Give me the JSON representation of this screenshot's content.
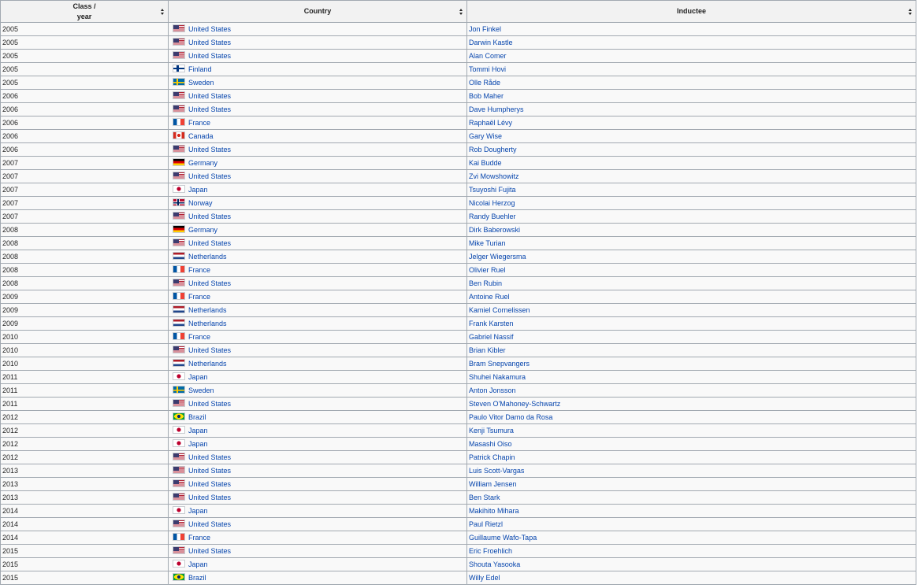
{
  "table": {
    "headers": {
      "year": "Class / year",
      "country": "Country",
      "inductee": "Inductee"
    },
    "rows": [
      {
        "year": "2005",
        "country": "United States",
        "flag": "us",
        "inductee": "Jon Finkel"
      },
      {
        "year": "2005",
        "country": "United States",
        "flag": "us",
        "inductee": "Darwin Kastle"
      },
      {
        "year": "2005",
        "country": "United States",
        "flag": "us",
        "inductee": "Alan Comer"
      },
      {
        "year": "2005",
        "country": "Finland",
        "flag": "fi",
        "inductee": "Tommi Hovi"
      },
      {
        "year": "2005",
        "country": "Sweden",
        "flag": "se",
        "inductee": "Olle Råde"
      },
      {
        "year": "2006",
        "country": "United States",
        "flag": "us",
        "inductee": "Bob Maher"
      },
      {
        "year": "2006",
        "country": "United States",
        "flag": "us",
        "inductee": "Dave Humpherys"
      },
      {
        "year": "2006",
        "country": "France",
        "flag": "fr",
        "inductee": "Raphaël Lévy"
      },
      {
        "year": "2006",
        "country": "Canada",
        "flag": "ca",
        "inductee": "Gary Wise"
      },
      {
        "year": "2006",
        "country": "United States",
        "flag": "us",
        "inductee": "Rob Dougherty"
      },
      {
        "year": "2007",
        "country": "Germany",
        "flag": "de",
        "inductee": "Kai Budde"
      },
      {
        "year": "2007",
        "country": "United States",
        "flag": "us",
        "inductee": "Zvi Mowshowitz"
      },
      {
        "year": "2007",
        "country": "Japan",
        "flag": "jp",
        "inductee": "Tsuyoshi Fujita"
      },
      {
        "year": "2007",
        "country": "Norway",
        "flag": "no",
        "inductee": "Nicolai Herzog"
      },
      {
        "year": "2007",
        "country": "United States",
        "flag": "us",
        "inductee": "Randy Buehler"
      },
      {
        "year": "2008",
        "country": "Germany",
        "flag": "de",
        "inductee": "Dirk Baberowski"
      },
      {
        "year": "2008",
        "country": "United States",
        "flag": "us",
        "inductee": "Mike Turian"
      },
      {
        "year": "2008",
        "country": "Netherlands",
        "flag": "nl",
        "inductee": "Jelger Wiegersma"
      },
      {
        "year": "2008",
        "country": "France",
        "flag": "fr",
        "inductee": "Olivier Ruel"
      },
      {
        "year": "2008",
        "country": "United States",
        "flag": "us",
        "inductee": "Ben Rubin"
      },
      {
        "year": "2009",
        "country": "France",
        "flag": "fr",
        "inductee": "Antoine Ruel"
      },
      {
        "year": "2009",
        "country": "Netherlands",
        "flag": "nl",
        "inductee": "Kamiel Cornelissen"
      },
      {
        "year": "2009",
        "country": "Netherlands",
        "flag": "nl",
        "inductee": "Frank Karsten"
      },
      {
        "year": "2010",
        "country": "France",
        "flag": "fr",
        "inductee": "Gabriel Nassif"
      },
      {
        "year": "2010",
        "country": "United States",
        "flag": "us",
        "inductee": "Brian Kibler"
      },
      {
        "year": "2010",
        "country": "Netherlands",
        "flag": "nl",
        "inductee": "Bram Snepvangers"
      },
      {
        "year": "2011",
        "country": "Japan",
        "flag": "jp",
        "inductee": "Shuhei Nakamura"
      },
      {
        "year": "2011",
        "country": "Sweden",
        "flag": "se",
        "inductee": "Anton Jonsson"
      },
      {
        "year": "2011",
        "country": "United States",
        "flag": "us",
        "inductee": "Steven O'Mahoney-Schwartz"
      },
      {
        "year": "2012",
        "country": "Brazil",
        "flag": "br",
        "inductee": "Paulo Vitor Damo da Rosa"
      },
      {
        "year": "2012",
        "country": "Japan",
        "flag": "jp",
        "inductee": "Kenji Tsumura"
      },
      {
        "year": "2012",
        "country": "Japan",
        "flag": "jp",
        "inductee": "Masashi Oiso"
      },
      {
        "year": "2012",
        "country": "United States",
        "flag": "us",
        "inductee": "Patrick Chapin"
      },
      {
        "year": "2013",
        "country": "United States",
        "flag": "us",
        "inductee": "Luis Scott-Vargas"
      },
      {
        "year": "2013",
        "country": "United States",
        "flag": "us",
        "inductee": "William Jensen"
      },
      {
        "year": "2013",
        "country": "United States",
        "flag": "us",
        "inductee": "Ben Stark"
      },
      {
        "year": "2014",
        "country": "Japan",
        "flag": "jp",
        "inductee": "Makihito Mihara"
      },
      {
        "year": "2014",
        "country": "United States",
        "flag": "us",
        "inductee": "Paul Rietzl"
      },
      {
        "year": "2014",
        "country": "France",
        "flag": "fr",
        "inductee": "Guillaume Wafo-Tapa"
      },
      {
        "year": "2015",
        "country": "United States",
        "flag": "us",
        "inductee": "Eric Froehlich"
      },
      {
        "year": "2015",
        "country": "Japan",
        "flag": "jp",
        "inductee": "Shouta Yasooka"
      },
      {
        "year": "2015",
        "country": "Brazil",
        "flag": "br",
        "inductee": "Willy Edel"
      }
    ]
  }
}
